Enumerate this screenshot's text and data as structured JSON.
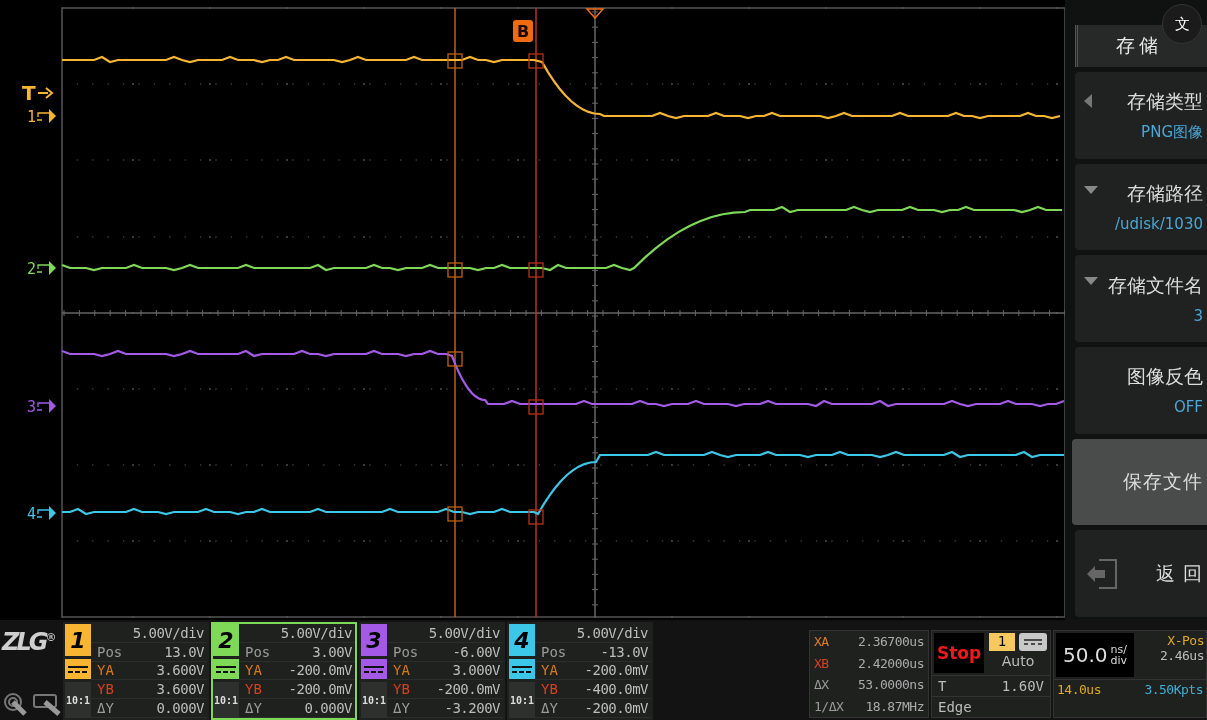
{
  "markers": [
    {
      "label": "T",
      "kind": "trigger",
      "color": "#f7b531"
    },
    {
      "label": "1",
      "kind": "channel",
      "color": "#f7b531"
    },
    {
      "label": "2",
      "kind": "channel",
      "color": "#7ed957"
    },
    {
      "label": "3",
      "kind": "channel",
      "color": "#a45ae6"
    },
    {
      "label": "4",
      "kind": "channel",
      "color": "#3cc6e8"
    }
  ],
  "cursor_tag": "B",
  "translate_button": "文",
  "menu": {
    "title": "存储",
    "items": [
      {
        "kind": "cycle",
        "label": "存储类型",
        "value": "PNG图像",
        "selected": false
      },
      {
        "kind": "dropdown",
        "label": "存储路径",
        "value": "/udisk/1030",
        "selected": false
      },
      {
        "kind": "dropdown",
        "label": "存储文件名",
        "value": "3",
        "selected": false
      },
      {
        "kind": "toggle",
        "label": "图像反色",
        "value": "OFF",
        "selected": false
      },
      {
        "kind": "action",
        "label": "保存文件",
        "selected": true
      },
      {
        "kind": "back",
        "label": "返 回",
        "selected": false
      }
    ]
  },
  "logo": {
    "text": "ZLG",
    "mark": "®"
  },
  "channels": [
    {
      "number": "1",
      "color": "#f7b531",
      "selected": false,
      "scale": "5.00V/div",
      "pos_label": "Pos",
      "pos": "13.0V",
      "probe": "10:1",
      "rows": [
        {
          "label": "YA",
          "value": "3.600V"
        },
        {
          "label": "YB",
          "value": "3.600V"
        },
        {
          "label": "ΔY",
          "value": "0.000V"
        }
      ]
    },
    {
      "number": "2",
      "color": "#7ed957",
      "selected": true,
      "scale": "5.00V/div",
      "pos_label": "Pos",
      "pos": "3.00V",
      "probe": "10:1",
      "rows": [
        {
          "label": "YA",
          "value": "-200.0mV"
        },
        {
          "label": "YB",
          "value": "-200.0mV"
        },
        {
          "label": "ΔY",
          "value": "0.000V"
        }
      ]
    },
    {
      "number": "3",
      "color": "#a45ae6",
      "selected": false,
      "scale": "5.00V/div",
      "pos_label": "Pos",
      "pos": "-6.00V",
      "probe": "10:1",
      "rows": [
        {
          "label": "YA",
          "value": "3.000V"
        },
        {
          "label": "YB",
          "value": "-200.0mV"
        },
        {
          "label": "ΔY",
          "value": "-3.200V"
        }
      ]
    },
    {
      "number": "4",
      "color": "#3cc6e8",
      "selected": false,
      "scale": "5.00V/div",
      "pos_label": "Pos",
      "pos": "-13.0V",
      "probe": "10:1",
      "rows": [
        {
          "label": "YA",
          "value": "-200.0mV"
        },
        {
          "label": "YB",
          "value": "-400.0mV"
        },
        {
          "label": "ΔY",
          "value": "-200.0mV"
        }
      ]
    }
  ],
  "cursor_readouts": [
    {
      "label": "XA",
      "value": "2.36700us",
      "color": "#e07a1c"
    },
    {
      "label": "XB",
      "value": "2.42000us",
      "color": "#d8401c"
    },
    {
      "label": "ΔX",
      "value": "53.0000ns",
      "color": "#9a9a9a"
    },
    {
      "label": "1/ΔX",
      "value": "18.87MHz",
      "color": "#9a9a9a"
    }
  ],
  "trigger": {
    "run_state": "Stop",
    "source": "1",
    "mode": "Auto",
    "label": "T",
    "reading": "1.60V",
    "type": "Edge"
  },
  "timebase": {
    "scale": "50.0",
    "unit_top": "ns/",
    "unit_bottom": "div",
    "xpos_label": "X-Pos",
    "xpos": "2.46us",
    "delay": "14.0us",
    "depth": "3.50Kpts"
  }
}
